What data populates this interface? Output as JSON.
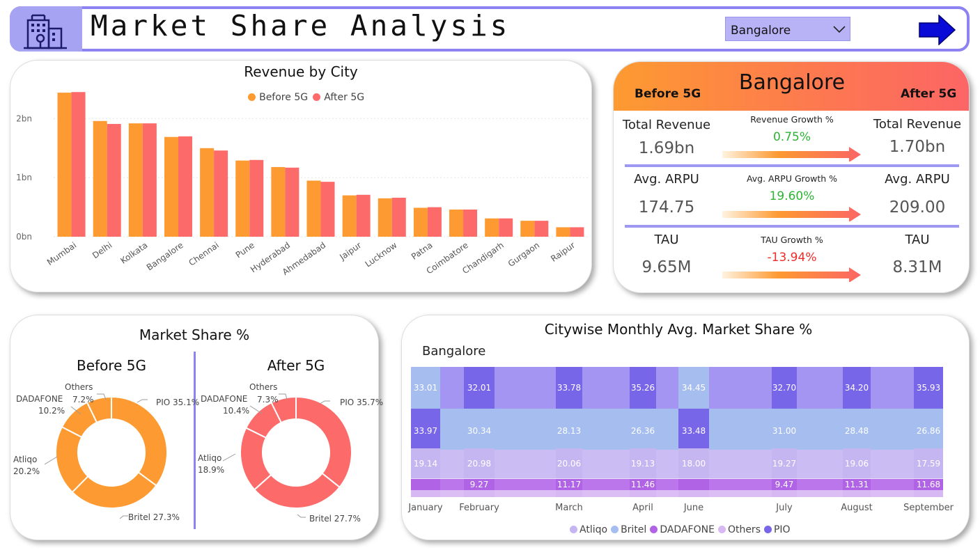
{
  "header": {
    "title": "Market Share Analysis",
    "city_selected": "Bangalore"
  },
  "revenue_chart": {
    "title": "Revenue by City",
    "legend": [
      {
        "label": "Before 5G",
        "color": "#fd9a31"
      },
      {
        "label": "After 5G",
        "color": "#fd6a6a"
      }
    ],
    "y_ticks": [
      "0bn",
      "1bn",
      "2bn"
    ]
  },
  "chart_data": [
    {
      "type": "bar",
      "title": "Revenue by City",
      "categories": [
        "Mumbai",
        "Delhi",
        "Kolkata",
        "Bangalore",
        "Chennai",
        "Pune",
        "Hyderabad",
        "Ahmedabad",
        "Jaipur",
        "Lucknow",
        "Patna",
        "Coimbatore",
        "Chandigarh",
        "Gurgaon",
        "Raipur"
      ],
      "series": [
        {
          "name": "Before 5G",
          "values": [
            2.44,
            1.96,
            1.92,
            1.69,
            1.5,
            1.29,
            1.18,
            0.95,
            0.7,
            0.65,
            0.49,
            0.46,
            0.31,
            0.27,
            0.16
          ]
        },
        {
          "name": "After 5G",
          "values": [
            2.45,
            1.91,
            1.92,
            1.7,
            1.46,
            1.3,
            1.17,
            0.93,
            0.71,
            0.66,
            0.5,
            0.46,
            0.31,
            0.27,
            0.16
          ]
        }
      ],
      "ylim": [
        0,
        2.5
      ],
      "y_ticks": [
        "0bn",
        "1bn",
        "2bn"
      ],
      "grid": true,
      "legend_position": "top-center"
    },
    {
      "type": "pie",
      "title": "Before 5G",
      "labels": [
        "PIO",
        "Britel",
        "Atliqo",
        "DADAFONE",
        "Others"
      ],
      "values": [
        35.1,
        27.3,
        20.2,
        10.2,
        7.2
      ]
    },
    {
      "type": "pie",
      "title": "After 5G",
      "labels": [
        "PIO",
        "Britel",
        "Atliqo",
        "DADAFONE",
        "Others"
      ],
      "values": [
        35.7,
        27.7,
        18.9,
        10.4,
        7.3
      ]
    },
    {
      "type": "area",
      "title": "Citywise Monthly Avg. Market Share %",
      "subtitle": "Bangalore",
      "categories": [
        "January",
        "February",
        "March",
        "April",
        "June",
        "July",
        "August",
        "September"
      ],
      "series": [
        {
          "name": "PIO",
          "values": [
            33.97,
            32.01,
            33.78,
            35.26,
            33.48,
            32.7,
            34.2,
            35.93
          ]
        },
        {
          "name": "Britel",
          "values": [
            33.01,
            30.34,
            28.13,
            26.36,
            34.45,
            31.0,
            28.48,
            26.86
          ]
        },
        {
          "name": "Atliqo",
          "values": [
            19.14,
            20.98,
            20.06,
            19.13,
            18.0,
            19.27,
            19.06,
            17.59
          ]
        },
        {
          "name": "DADAFONE",
          "values": [
            null,
            9.27,
            11.17,
            11.46,
            null,
            9.47,
            11.31,
            11.68
          ]
        },
        {
          "name": "Others",
          "values": [
            null,
            null,
            null,
            null,
            null,
            null,
            null,
            null
          ]
        }
      ],
      "legend_position": "bottom-center"
    }
  ],
  "kpi": {
    "city": "Bangalore",
    "before_label": "Before 5G",
    "after_label": "After 5G",
    "rows": [
      {
        "label": "Total Revenue",
        "before": "1.69bn",
        "after": "1.70bn",
        "growth_label": "Revenue Growth %",
        "growth": "0.75%",
        "growth_color": "#2bb533"
      },
      {
        "label": "Avg. ARPU",
        "before": "174.75",
        "after": "209.00",
        "growth_label": "Avg. ARPU Growth %",
        "growth": "19.60%",
        "growth_color": "#2bb533"
      },
      {
        "label": "TAU",
        "before": "9.65M",
        "after": "8.31M",
        "growth_label": "TAU Growth %",
        "growth": "-13.94%",
        "growth_color": "#ee2b2b"
      }
    ]
  },
  "market_share": {
    "title": "Market Share %",
    "before": {
      "title": "Before 5G",
      "labels": {
        "pio": "PIO 35.1%",
        "britel": "Britel 27.3%",
        "atliqo_name": "Atliqo",
        "atliqo_val": "20.2%",
        "dadafone_name": "DADAFONE",
        "dadafone_val": "10.2%",
        "others_name": "Others",
        "others_val": "7.2%"
      }
    },
    "after": {
      "title": "After 5G",
      "labels": {
        "pio": "PIO 35.7%",
        "britel": "Britel 27.7%",
        "atliqo_name": "Atliqo",
        "atliqo_val": "18.9%",
        "dadafone_name": "DADAFONE",
        "dadafone_val": "10.4%",
        "others_name": "Others",
        "others_val": "7.3%"
      }
    },
    "colors": {
      "before": "#fd9a31",
      "after": "#fd6a6a"
    }
  },
  "citywise": {
    "title": "Citywise Monthly Avg. Market Share %",
    "city": "Bangalore",
    "legend": [
      {
        "label": "Atliqo",
        "color": "#c5b6f2"
      },
      {
        "label": "Britel",
        "color": "#a6bdf0"
      },
      {
        "label": "DADAFONE",
        "color": "#b163e6"
      },
      {
        "label": "Others",
        "color": "#d8b8f2"
      },
      {
        "label": "PIO",
        "color": "#7766e8"
      }
    ]
  }
}
